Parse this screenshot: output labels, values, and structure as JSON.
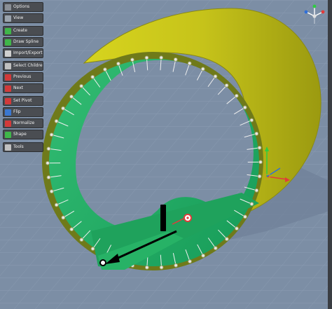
{
  "toolbar": {
    "groups": [
      [
        {
          "label": "Options",
          "icon": "options-icon",
          "color": "#8a8f96"
        },
        {
          "label": "View",
          "icon": "view-icon",
          "color": "#9aa3ad"
        }
      ],
      [
        {
          "label": "Create",
          "icon": "create-icon",
          "color": "#3fb64a"
        },
        {
          "label": "Draw Spline",
          "icon": "draw-spline-icon",
          "color": "#3fb64a"
        },
        {
          "label": "Import/Export",
          "icon": "import-export-icon",
          "color": "#d0d0d0"
        }
      ],
      [
        {
          "label": "Select Children",
          "icon": "select-children-icon",
          "color": "#c0c0c0"
        },
        {
          "label": "Previous",
          "icon": "previous-icon",
          "color": "#d23a3a"
        },
        {
          "label": "Next",
          "icon": "next-icon",
          "color": "#d23a3a"
        }
      ],
      [
        {
          "label": "Set Pivot",
          "icon": "set-pivot-icon",
          "color": "#d23a3a"
        },
        {
          "label": "Flip",
          "icon": "flip-icon",
          "color": "#3a78d2"
        },
        {
          "label": "Normalize",
          "icon": "normalize-icon",
          "color": "#d23a3a"
        },
        {
          "label": "Shape",
          "icon": "shape-icon",
          "color": "#3fb64a"
        }
      ],
      [
        {
          "label": "Tools",
          "icon": "tools-icon",
          "color": "#c0c0c0"
        }
      ]
    ]
  },
  "scene": {
    "colors": {
      "grid": "#7d8fa6",
      "tube_outer": "#c8c81c",
      "tube_rim": "#6f7a1a",
      "inner_surface": "#23a864",
      "spline_points": "#e8e8e8",
      "cursor": "#000000"
    }
  }
}
